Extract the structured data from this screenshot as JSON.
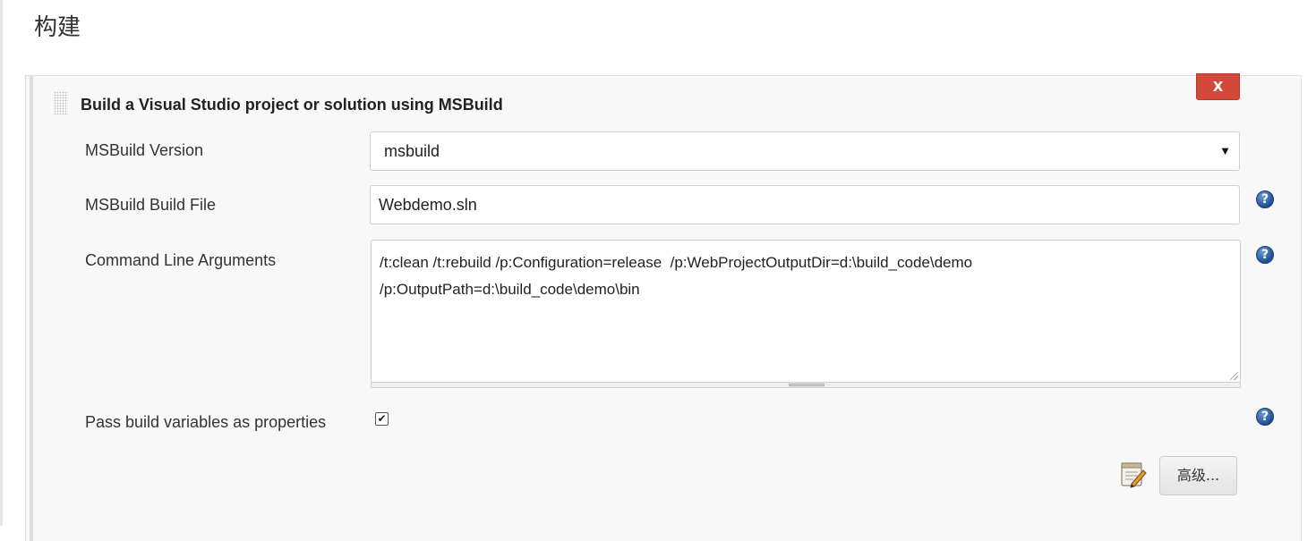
{
  "section": {
    "title": "构建"
  },
  "builder": {
    "title": "Build a Visual Studio project or solution using MSBuild",
    "delete_label": "X",
    "fields": {
      "msbuild_version": {
        "label": "MSBuild Version",
        "value": "msbuild"
      },
      "build_file": {
        "label": "MSBuild Build File",
        "value": "Webdemo.sln"
      },
      "cmd_args": {
        "label": "Command Line Arguments",
        "line1": "/t:clean /t:rebuild /p:Configuration=release  /p:WebProjectOutputDir=d:\\build_code\\demo",
        "line2": "/p:OutputPath=d:\\build_code\\demo\\bin"
      },
      "pass_vars": {
        "label": "Pass build variables as properties",
        "checked_mark": "✔"
      }
    },
    "help_glyph": "?",
    "advanced_label": "高级..."
  },
  "icons": {
    "help": "help-icon",
    "notepad": "notepad-icon",
    "dropdown": "chevron-down-icon",
    "drag": "drag-handle-icon"
  },
  "colors": {
    "delete_button": "#d24939",
    "help_icon": "#1e4f92",
    "panel_bg": "#f8f8f8"
  }
}
